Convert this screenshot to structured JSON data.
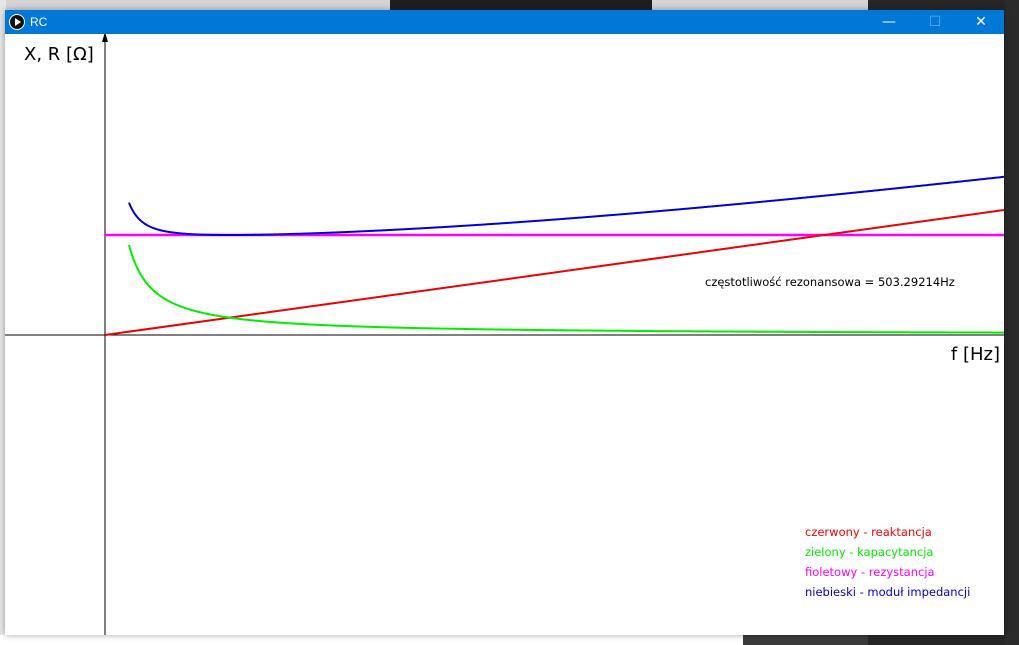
{
  "window": {
    "title": "RC",
    "minimize_glyph": "—",
    "maximize_glyph": "☐",
    "close_glyph": "✕"
  },
  "plot": {
    "y_axis_label": "X, R [Ω]",
    "x_axis_label": "f [Hz]",
    "annotation": "częstotliwość rezonansowa = 503.29214Hz",
    "legend": [
      {
        "text": "czerwony - reaktancja",
        "color": "#ff0000"
      },
      {
        "text": "zielony - kapacytancja",
        "color": "#00ee00"
      },
      {
        "text": "fioletowy - rezystancja",
        "color": "#ff00ff"
      },
      {
        "text": "niebieski - moduł impedancji",
        "color": "#0000dd"
      }
    ]
  }
}
